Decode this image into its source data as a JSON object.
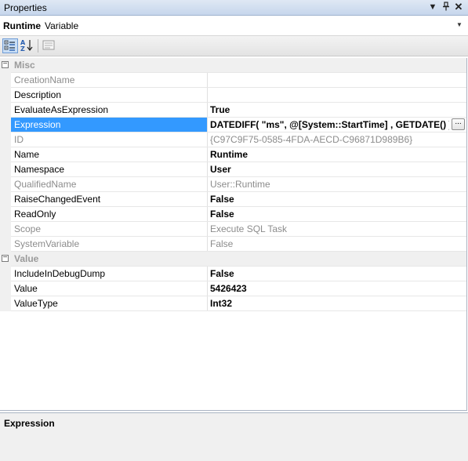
{
  "window": {
    "title": "Properties"
  },
  "object": {
    "name": "Runtime",
    "type": "Variable"
  },
  "categories": [
    {
      "label": "Misc",
      "rows": [
        {
          "name": "CreationName",
          "value": "",
          "readonly": true,
          "bold": false
        },
        {
          "name": "Description",
          "value": "",
          "readonly": false,
          "bold": false
        },
        {
          "name": "EvaluateAsExpression",
          "value": "True",
          "readonly": false,
          "bold": true
        },
        {
          "name": "Expression",
          "value": "DATEDIFF( \"ms\", @[System::StartTime] , GETDATE() )",
          "readonly": false,
          "bold": true,
          "selected": true,
          "ellipsis": "..."
        },
        {
          "name": "ID",
          "value": "{C97C9F75-0585-4FDA-AECD-C96871D989B6}",
          "readonly": true,
          "bold": false
        },
        {
          "name": "Name",
          "value": "Runtime",
          "readonly": false,
          "bold": true
        },
        {
          "name": "Namespace",
          "value": "User",
          "readonly": false,
          "bold": true
        },
        {
          "name": "QualifiedName",
          "value": "User::Runtime",
          "readonly": true,
          "bold": false
        },
        {
          "name": "RaiseChangedEvent",
          "value": "False",
          "readonly": false,
          "bold": true
        },
        {
          "name": "ReadOnly",
          "value": "False",
          "readonly": false,
          "bold": true
        },
        {
          "name": "Scope",
          "value": "Execute SQL Task",
          "readonly": true,
          "bold": false
        },
        {
          "name": "SystemVariable",
          "value": "False",
          "readonly": true,
          "bold": false
        }
      ]
    },
    {
      "label": "Value",
      "rows": [
        {
          "name": "IncludeInDebugDump",
          "value": "False",
          "readonly": false,
          "bold": true
        },
        {
          "name": "Value",
          "value": "5426423",
          "readonly": false,
          "bold": true
        },
        {
          "name": "ValueType",
          "value": "Int32",
          "readonly": false,
          "bold": true
        }
      ]
    }
  ],
  "description": {
    "title": "Expression"
  },
  "colors": {
    "selection": "#3399ff",
    "category_text": "#9a9a9a",
    "readonly_text": "#8c8c8c"
  }
}
